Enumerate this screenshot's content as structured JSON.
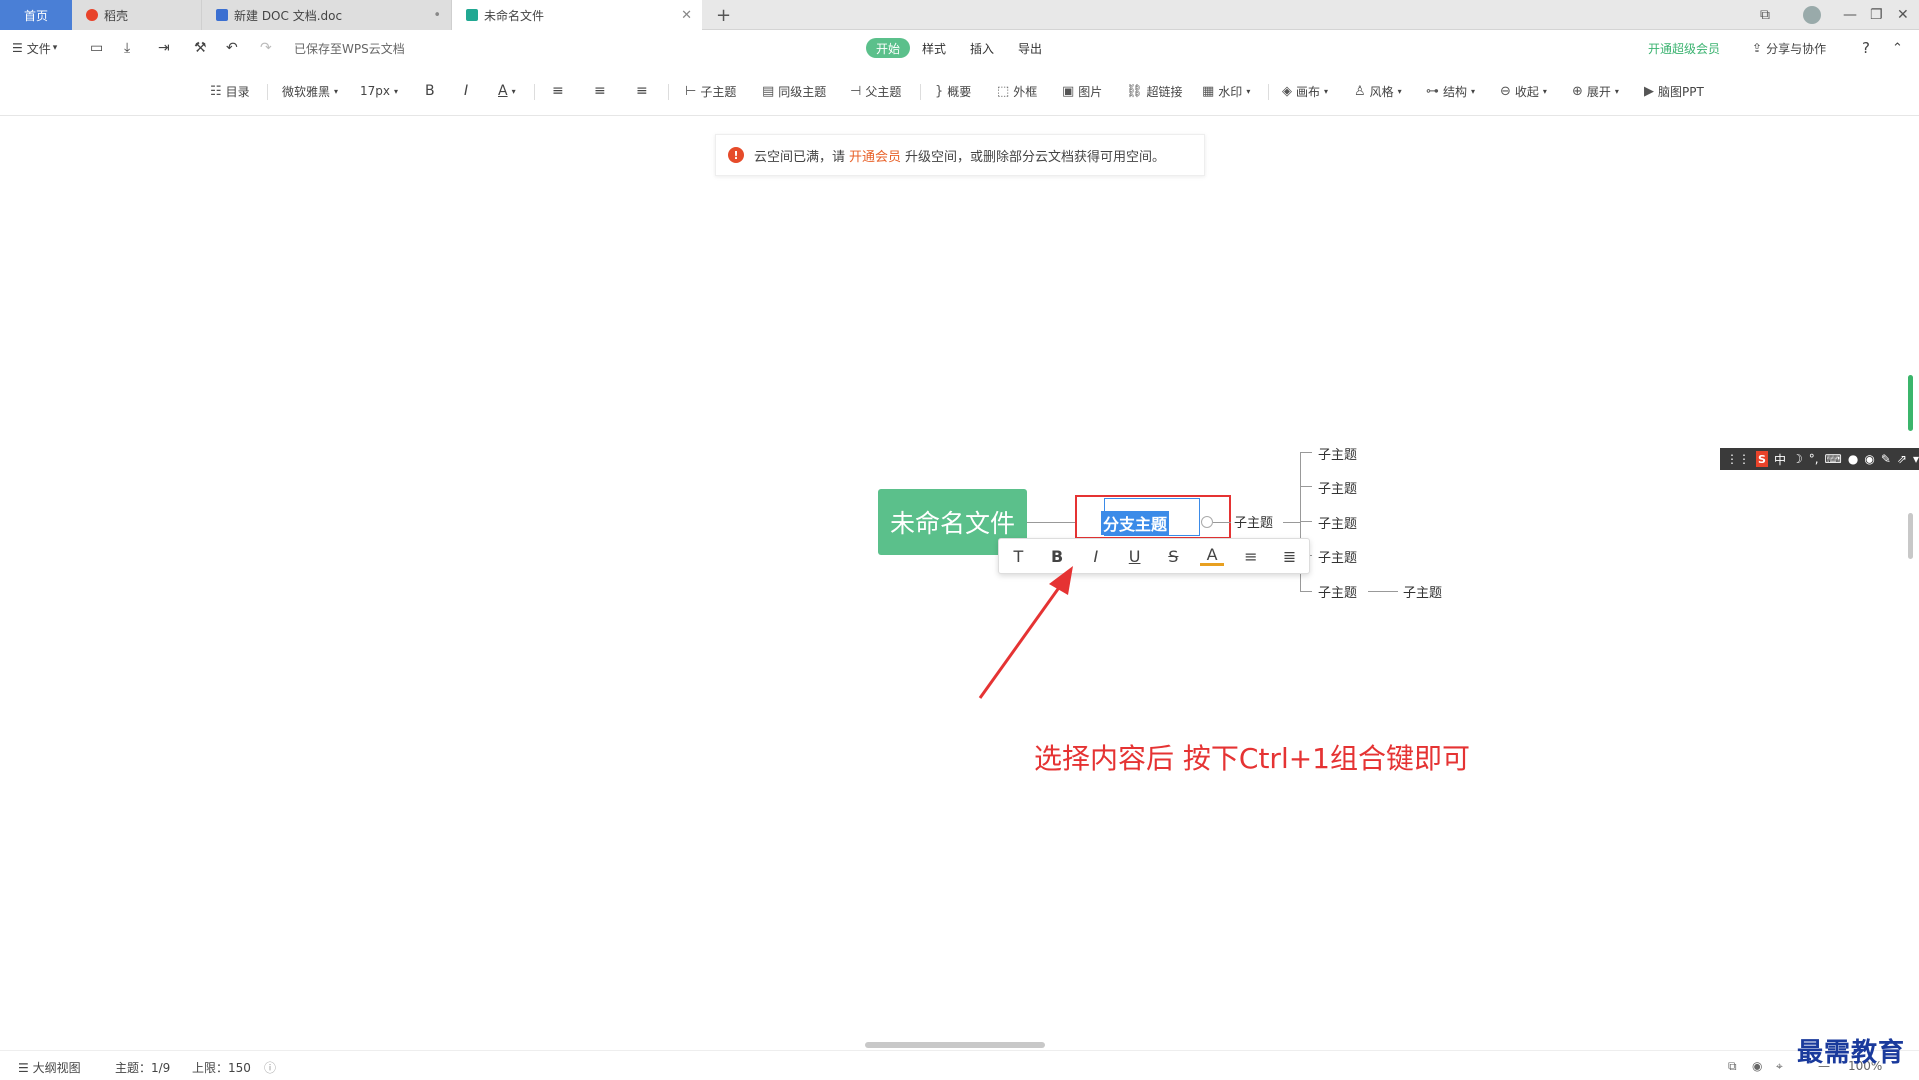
{
  "tabs": {
    "home": "首页",
    "t1": "稻壳",
    "t2": "新建 DOC 文档.doc",
    "t3": "未命名文件",
    "add": "+"
  },
  "menu": {
    "file": "文件",
    "saved": "已保存至WPS云文档",
    "tabs": [
      "开始",
      "样式",
      "插入",
      "导出"
    ],
    "vip": "开通超级会员",
    "share": "分享与协作",
    "help": "?"
  },
  "toolbar": {
    "outline": "目录",
    "font": "微软雅黑",
    "size": "17px",
    "bold": "B",
    "italic": "I",
    "color": "A",
    "child": "子主题",
    "sibling": "同级主题",
    "parent": "父主题",
    "summary": "概要",
    "frame": "外框",
    "image": "图片",
    "link": "超链接",
    "watermark": "水印",
    "canvas": "画布",
    "style": "风格",
    "structure": "结构",
    "collapse": "收起",
    "expand": "展开",
    "ppt": "脑图PPT"
  },
  "notice": {
    "pre": "云空间已满，请",
    "link": "开通会员",
    "post": "升级空间，或删除部分云文档获得可用空间。"
  },
  "mindmap": {
    "root": "未命名文件",
    "branch": "分支主题",
    "mid": "子主题",
    "subs": [
      "子主题",
      "子主题",
      "子主题",
      "子主题",
      "子主题"
    ],
    "deep": "子主题"
  },
  "float_toolbar": [
    "T",
    "B",
    "I",
    "U",
    "S",
    "A",
    "≡",
    "≣"
  ],
  "annotation": "选择内容后 按下Ctrl+1组合键即可",
  "ime": {
    "logo": "S",
    "lang": "中"
  },
  "status": {
    "outline": "大纲视图",
    "topics": "主题：1/9",
    "limit": "上限：150",
    "zoom": "100%"
  },
  "watermark_text": "最需教育",
  "colors": {
    "accent": "#5bc08b",
    "highlight": "#e53333",
    "select": "#3b8be8"
  }
}
